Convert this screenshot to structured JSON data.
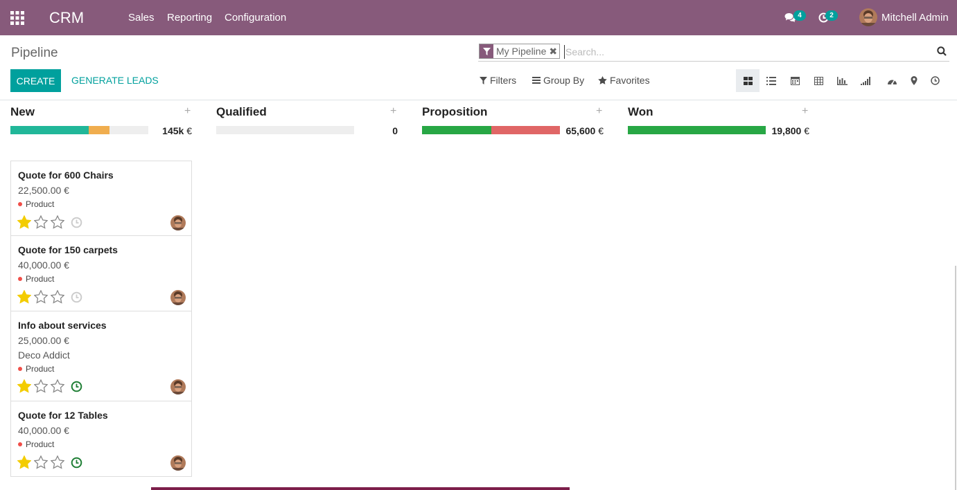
{
  "navbar": {
    "brand": "CRM",
    "menu": [
      "Sales",
      "Reporting",
      "Configuration"
    ],
    "messages_count": "4",
    "activities_count": "2",
    "user_name": "Mitchell Admin",
    "bg_color": "#875a7b"
  },
  "control_panel": {
    "breadcrumb": "Pipeline",
    "facet_value": "My Pipeline",
    "search_placeholder": "Search...",
    "create_label": "CREATE",
    "generate_leads_label": "GENERATE LEADS",
    "filters_label": "Filters",
    "group_by_label": "Group By",
    "favorites_label": "Favorites",
    "views": [
      "kanban-icon",
      "list-icon",
      "calendar-icon",
      "pivot-icon",
      "graph-icon",
      "cohort-icon",
      "dashboard-icon",
      "map-icon",
      "activity-icon"
    ],
    "active_view": "kanban-icon"
  },
  "columns": [
    {
      "title": "New",
      "total": "145k",
      "currency": "€",
      "progress": [
        {
          "color": "#21b799",
          "fraction": 0.57
        },
        {
          "color": "#f0ad4e",
          "fraction": 0.15
        }
      ]
    },
    {
      "title": "Qualified",
      "total": "0",
      "currency": "",
      "progress": []
    },
    {
      "title": "Proposition",
      "total": "65,600",
      "currency": "€",
      "progress": [
        {
          "color": "#28a745",
          "fraction": 0.5
        },
        {
          "color": "#e06666",
          "fraction": 0.5
        }
      ]
    },
    {
      "title": "Won",
      "total": "19,800",
      "currency": "€",
      "progress": [
        {
          "color": "#28a745",
          "fraction": 1.0
        }
      ]
    }
  ],
  "cards": [
    {
      "title": "Quote for 600 Chairs",
      "amount": "22,500.00 €",
      "partner": "",
      "tag": "Product",
      "stars": 1,
      "activity": "planned-grey"
    },
    {
      "title": "Quote for 150 carpets",
      "amount": "40,000.00 €",
      "partner": "",
      "tag": "Product",
      "stars": 1,
      "activity": "planned-grey"
    },
    {
      "title": "Info about services",
      "amount": "25,000.00 €",
      "partner": "Deco Addict",
      "tag": "Product",
      "stars": 1,
      "activity": "planned-green"
    },
    {
      "title": "Quote for 12 Tables",
      "amount": "40,000.00 €",
      "partner": "",
      "tag": "Product",
      "stars": 1,
      "activity": "planned-green"
    }
  ]
}
